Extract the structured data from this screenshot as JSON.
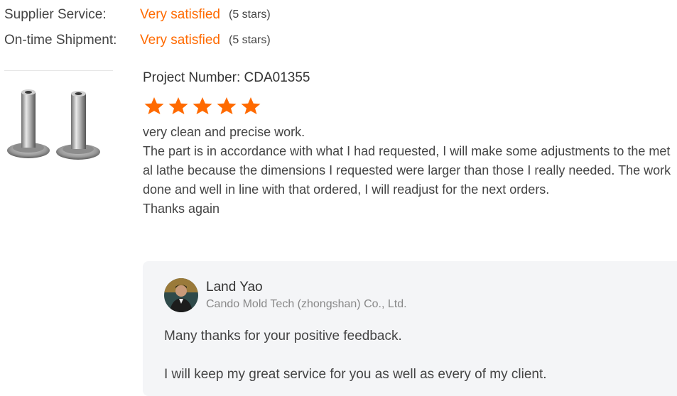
{
  "ratings": [
    {
      "label": "Supplier Service:",
      "value": "Very satisfied",
      "stars": "(5 stars)"
    },
    {
      "label": "On-time Shipment:",
      "value": "Very satisfied",
      "stars": "(5 stars)"
    }
  ],
  "review": {
    "project": "Project Number: CDA01355",
    "rating": 5,
    "lines": [
      "very clean and precise work.",
      "The part is in accordance with what I had requested, I will make some adjustments to the metal lathe because the dimensions I requested were larger than those I really needed. The work done and well in line with that ordered, I will readjust for the next orders.",
      "Thanks again"
    ]
  },
  "reply": {
    "name": "Land Yao",
    "company": "Cando Mold Tech (zhongshan) Co., Ltd.",
    "line1": "Many thanks for your positive feedback.",
    "line2": "I will keep my great service for you as well as every of my client."
  },
  "colors": {
    "accent": "#ff6a00",
    "reply_bg": "#f4f5f7"
  },
  "icons": {
    "star": "star-icon",
    "avatar": "avatar",
    "thumbnail": "product-thumbnail"
  }
}
